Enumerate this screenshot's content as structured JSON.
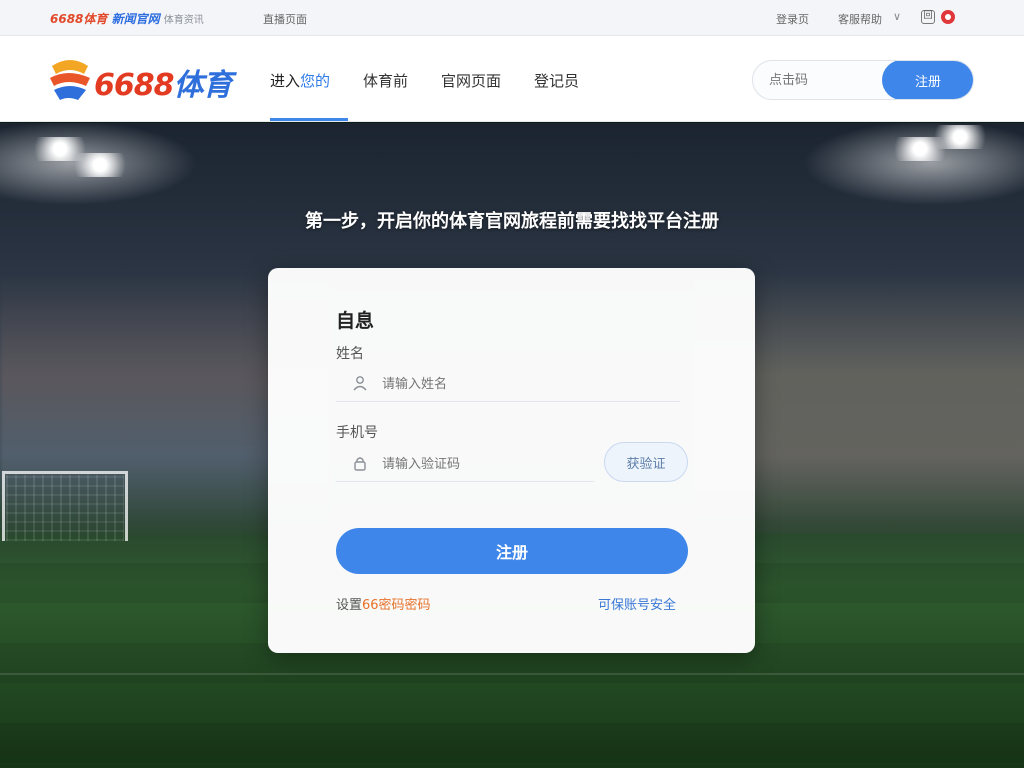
{
  "topbar": {
    "brand_a": "6688体育",
    "brand_b": "新闻官网",
    "brand_c": "体育资讯",
    "link_1": "直播页面",
    "link_2": "登录页",
    "link_3": "客服帮助",
    "chevron": "∨",
    "icon_a_glyph": "回"
  },
  "header": {
    "logo_num": "6688",
    "logo_cn": "体育",
    "nav": [
      {
        "pre": "进入",
        "hl": "您的"
      },
      {
        "pre": "体育前"
      },
      {
        "pre": "官网页面"
      },
      {
        "pre": "登记员"
      }
    ],
    "search_placeholder": "点击码",
    "search_button": "注册"
  },
  "hero": {
    "title": "第一步，开启你的体育官网旅程前需要找找平台注册"
  },
  "form": {
    "title": "自息",
    "name_label": "姓名",
    "name_placeholder": "请输入姓名",
    "phone_label": "手机号",
    "phone_placeholder": "请输入验证码",
    "code_button": "获验证",
    "submit": "注册",
    "link_left_pre": "设置",
    "link_left_accent": "66密码密码",
    "link_right": "可保账号安全"
  },
  "colors": {
    "accent": "#3e86ea",
    "logo_red": "#e23b22",
    "logo_blue": "#2f6fdc",
    "link_orange": "#e8702a"
  }
}
